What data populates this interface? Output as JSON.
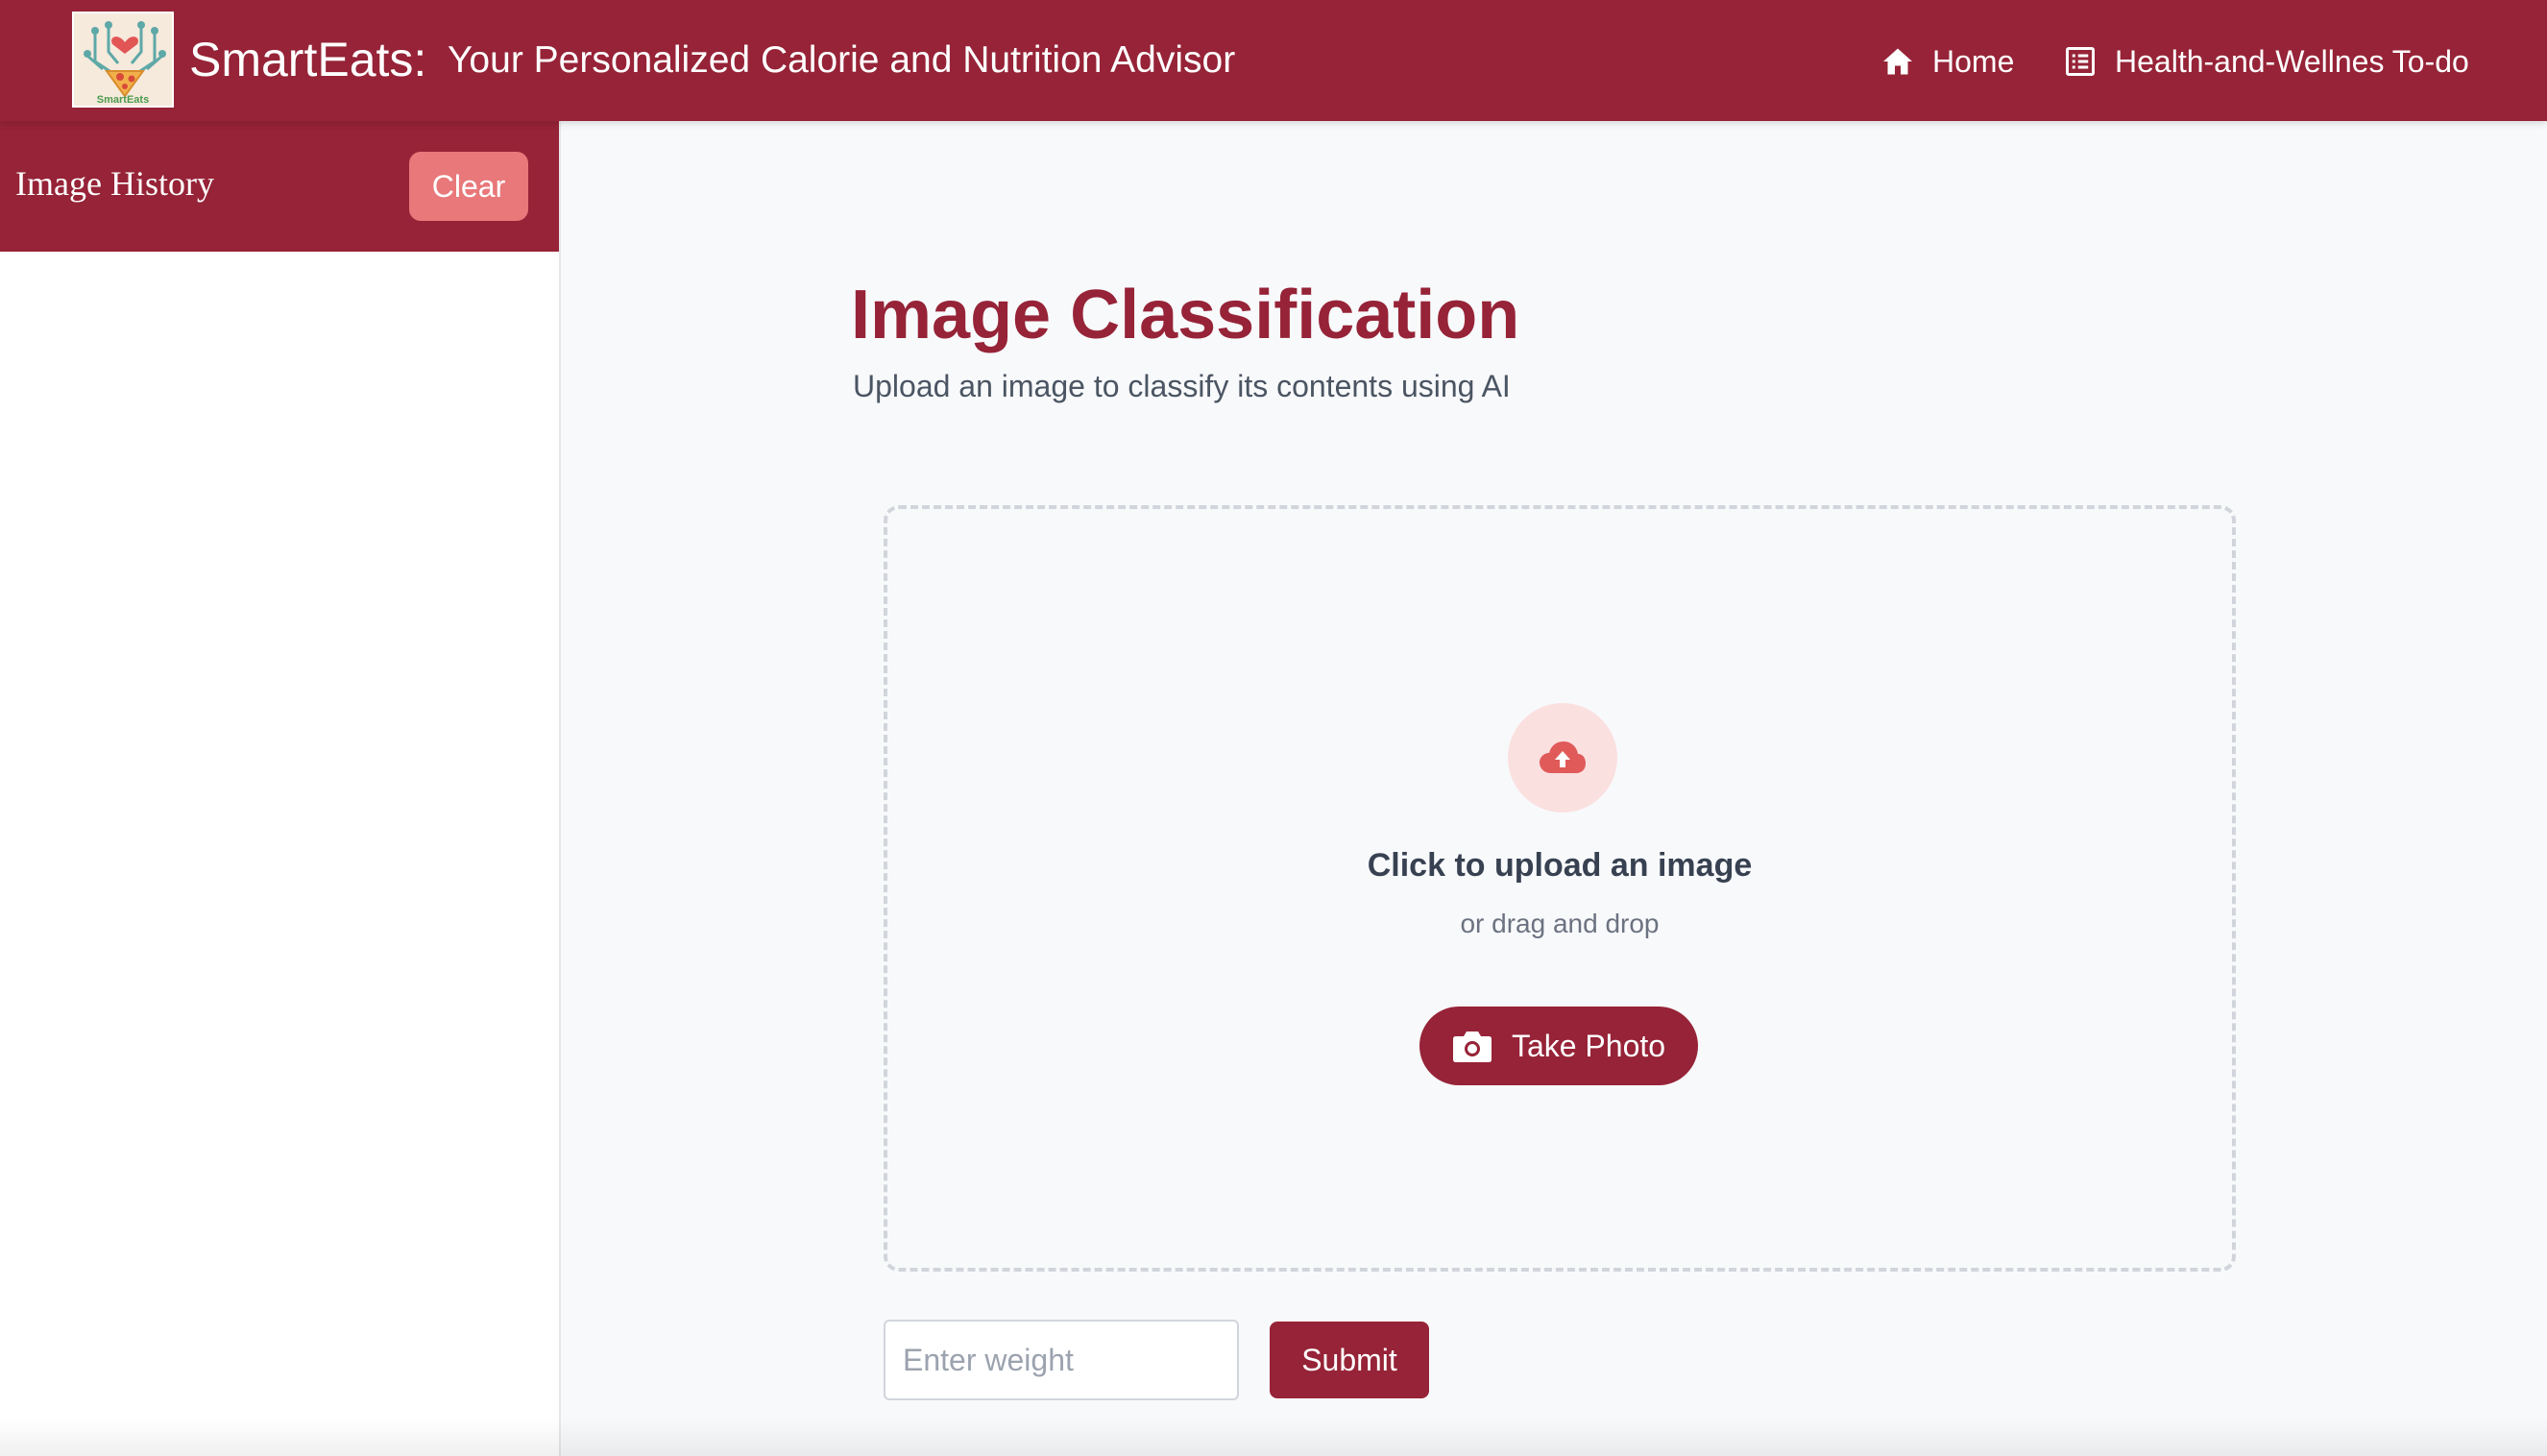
{
  "colors": {
    "brand": "#962337",
    "accent_light": "#e8787a",
    "upload_circle": "#fbe0e0",
    "upload_icon": "#e05a5a"
  },
  "header": {
    "logo_text": "SmartEats",
    "brand": "SmartEats:",
    "tagline": "Your Personalized Calorie and Nutrition Advisor",
    "nav": [
      {
        "label": "Home",
        "icon": "home-icon"
      },
      {
        "label": "Health-and-Wellnes To-do",
        "icon": "list-icon"
      }
    ]
  },
  "sidebar": {
    "title": "Image History",
    "clear_label": "Clear"
  },
  "main": {
    "title": "Image Classification",
    "subtitle": "Upload an image to classify its contents using AI",
    "dropzone": {
      "icon": "cloud-upload-icon",
      "primary": "Click to upload an image",
      "secondary": "or drag and drop",
      "take_photo_label": "Take Photo",
      "take_photo_icon": "camera-icon"
    },
    "weight_placeholder": "Enter weight",
    "submit_label": "Submit"
  }
}
